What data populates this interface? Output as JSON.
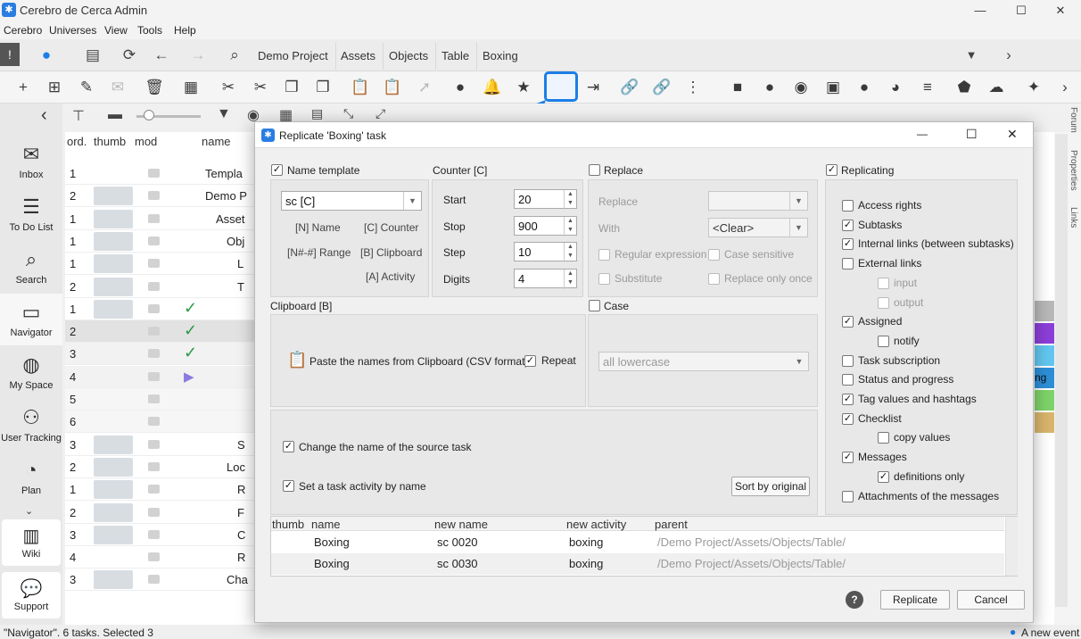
{
  "window": {
    "title": "Cerebro de Cerca   Admin",
    "minimize": "—",
    "maximize": "☐",
    "close": "✕"
  },
  "menu": [
    "Cerebro",
    "Universes",
    "View",
    "Tools",
    "Help"
  ],
  "tabs": [
    "Demo Project",
    "Assets",
    "Objects",
    "Table",
    "Boxing"
  ],
  "sidebar": {
    "items": [
      {
        "label": "Inbox",
        "icon": "envelope-icon"
      },
      {
        "label": "To Do List",
        "icon": "list-icon"
      },
      {
        "label": "Search",
        "icon": "search-icon"
      },
      {
        "label": "Navigator",
        "icon": "folder-icon"
      },
      {
        "label": "My Space",
        "icon": "globe-icon"
      },
      {
        "label": "User Tracking",
        "icon": "users-icon"
      },
      {
        "label": "Plan",
        "icon": "clock-plus-icon"
      },
      {
        "label": "Wiki",
        "icon": "book-icon"
      },
      {
        "label": "Support",
        "icon": "chat-icon"
      }
    ]
  },
  "grid": {
    "headers": [
      "ord.",
      "thumb",
      "mod",
      "name"
    ],
    "rows": [
      {
        "ord": "1",
        "name": "Templa",
        "indent": 0,
        "thumb": false,
        "check": ""
      },
      {
        "ord": "2",
        "name": "Demo P",
        "indent": 0,
        "thumb": true,
        "check": ""
      },
      {
        "ord": "1",
        "name": "Asset",
        "indent": 1,
        "thumb": true,
        "check": ""
      },
      {
        "ord": "1",
        "name": "Obj",
        "indent": 2,
        "thumb": true,
        "check": ""
      },
      {
        "ord": "1",
        "name": "L",
        "indent": 3,
        "thumb": true,
        "check": ""
      },
      {
        "ord": "2",
        "name": "T",
        "indent": 3,
        "thumb": true,
        "check": ""
      },
      {
        "ord": "1",
        "name": "",
        "indent": 4,
        "thumb": true,
        "check": "✓"
      },
      {
        "ord": "2",
        "name": "",
        "indent": 4,
        "thumb": false,
        "check": "✓"
      },
      {
        "ord": "3",
        "name": "",
        "indent": 4,
        "thumb": false,
        "check": "✓"
      },
      {
        "ord": "4",
        "name": "",
        "indent": 4,
        "thumb": false,
        "check": "▶"
      },
      {
        "ord": "5",
        "name": "",
        "indent": 4,
        "thumb": false,
        "check": ""
      },
      {
        "ord": "6",
        "name": "",
        "indent": 4,
        "thumb": false,
        "check": ""
      },
      {
        "ord": "3",
        "name": "S",
        "indent": 3,
        "thumb": true,
        "check": ""
      },
      {
        "ord": "2",
        "name": "Loc",
        "indent": 2,
        "thumb": true,
        "check": ""
      },
      {
        "ord": "1",
        "name": "R",
        "indent": 3,
        "thumb": true,
        "check": ""
      },
      {
        "ord": "2",
        "name": "F",
        "indent": 3,
        "thumb": true,
        "check": ""
      },
      {
        "ord": "3",
        "name": "C",
        "indent": 3,
        "thumb": true,
        "check": ""
      },
      {
        "ord": "4",
        "name": "R",
        "indent": 3,
        "thumb": false,
        "check": ""
      },
      {
        "ord": "3",
        "name": "Cha",
        "indent": 2,
        "thumb": true,
        "check": ""
      }
    ]
  },
  "right_strip": [
    "Forum",
    "Properties",
    "Links"
  ],
  "right_partial_text": "ng",
  "status": {
    "left": "\"Navigator\". 6 tasks. Selected 3",
    "right": "A new event"
  },
  "dialog": {
    "title": "Replicate 'Boxing' task",
    "name_template": {
      "label": "Name template",
      "checked": true,
      "value": "sc [C]",
      "tokens": [
        "[N] Name",
        "[C] Counter",
        "[N#-#] Range",
        "[B] Clipboard",
        "[A] Activity"
      ]
    },
    "counter": {
      "label": "Counter [C]",
      "fields": [
        {
          "label": "Start",
          "value": "20"
        },
        {
          "label": "Stop",
          "value": "900"
        },
        {
          "label": "Step",
          "value": "10"
        },
        {
          "label": "Digits",
          "value": "4"
        }
      ]
    },
    "replace": {
      "label": "Replace",
      "checked": false,
      "replace_label": "Replace",
      "replace_value": "",
      "with_label": "With",
      "with_value": "<Clear>",
      "regex": "Regular expression",
      "case_sensitive": "Case sensitive",
      "substitute": "Substitute",
      "replace_once": "Replace only once"
    },
    "clipboard": {
      "label": "Clipboard [B]",
      "paste_text": "Paste the names from Clipboard (CSV format)",
      "repeat_label": "Repeat",
      "repeat_checked": true
    },
    "case": {
      "label": "Case",
      "checked": false,
      "value": "all lowercase"
    },
    "options": {
      "change_name": "Change the name of the source task",
      "set_activity": "Set a task activity by name",
      "sort_button": "Sort by original"
    },
    "replicating": {
      "label": "Replicating",
      "checked": true,
      "items": [
        {
          "label": "Access rights",
          "checked": false,
          "level": 0,
          "disabled": false
        },
        {
          "label": "Subtasks",
          "checked": true,
          "level": 0,
          "disabled": false
        },
        {
          "label": "Internal links (between subtasks)",
          "checked": true,
          "level": 0,
          "disabled": false
        },
        {
          "label": "External links",
          "checked": false,
          "level": 0,
          "disabled": false
        },
        {
          "label": "input",
          "checked": false,
          "level": 1,
          "disabled": true
        },
        {
          "label": "output",
          "checked": false,
          "level": 1,
          "disabled": true
        },
        {
          "label": "Assigned",
          "checked": true,
          "level": 0,
          "disabled": false
        },
        {
          "label": "notify",
          "checked": false,
          "level": 1,
          "disabled": false
        },
        {
          "label": "Task subscription",
          "checked": false,
          "level": 0,
          "disabled": false
        },
        {
          "label": "Status and progress",
          "checked": false,
          "level": 0,
          "disabled": false
        },
        {
          "label": "Tag values and hashtags",
          "checked": true,
          "level": 0,
          "disabled": false
        },
        {
          "label": "Checklist",
          "checked": true,
          "level": 0,
          "disabled": false
        },
        {
          "label": "copy values",
          "checked": false,
          "level": 1,
          "disabled": false
        },
        {
          "label": "Messages",
          "checked": true,
          "level": 0,
          "disabled": false
        },
        {
          "label": "definitions only",
          "checked": true,
          "level": 1,
          "disabled": false
        },
        {
          "label": "Attachments of the messages",
          "checked": false,
          "level": 0,
          "disabled": false
        }
      ]
    },
    "preview": {
      "headers": [
        "thumb",
        "name",
        "new name",
        "new activity",
        "parent"
      ],
      "rows": [
        {
          "name": "Boxing",
          "new_name": "sc 0020",
          "activity": "boxing",
          "parent": "/Demo Project/Assets/Objects/Table/"
        },
        {
          "name": "Boxing",
          "new_name": "sc 0030",
          "activity": "boxing",
          "parent": "/Demo Project/Assets/Objects/Table/"
        }
      ]
    },
    "buttons": {
      "help": "?",
      "replicate": "Replicate",
      "cancel": "Cancel"
    },
    "window_buttons": {
      "minimize": "—",
      "maximize": "☐",
      "close": "✕"
    }
  },
  "colors": {
    "accent": "#1c7ee6",
    "check_green": "#2e9a4c",
    "play_purple": "#8a7be0",
    "selection_row": "#e2e2e2"
  }
}
